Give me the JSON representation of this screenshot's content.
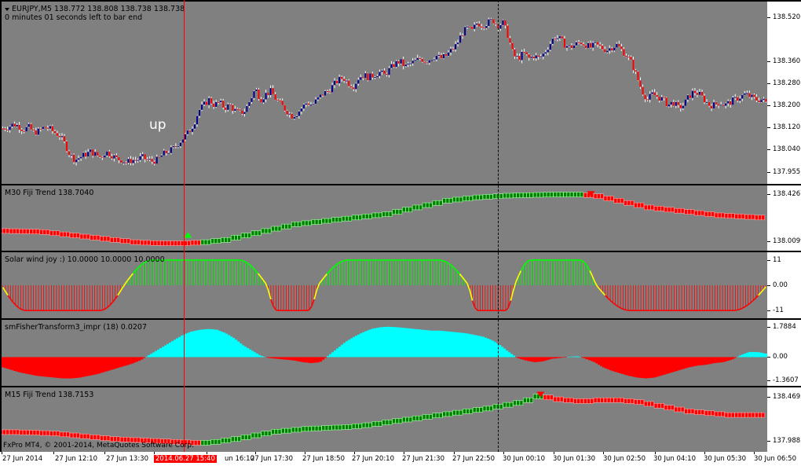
{
  "main": {
    "symbol_line": "EURJPY,M5  138.772 138.808 138.738 138.738",
    "countdown": "0 minutes 01 seconds left to bar end",
    "signal_label": "up",
    "scale_labels": [
      "138.520",
      "138.360",
      "138.280",
      "138.200",
      "138.120",
      "138.040",
      "137.955"
    ],
    "scale_values": [
      138.52,
      138.36,
      138.28,
      138.2,
      138.12,
      138.04,
      137.955
    ],
    "price_range": [
      137.93,
      138.56
    ],
    "close_path": [
      138.115,
      138.12,
      138.13,
      138.125,
      138.11,
      138.12,
      138.1,
      138.105,
      138.12,
      138.115,
      138.1,
      138.09,
      138.06,
      138.02,
      138.0,
      138.01,
      138.02,
      138.03,
      138.02,
      138.01,
      138.03,
      138.02,
      138.005,
      138.0,
      137.99,
      138.0,
      138.0,
      138.01,
      138.0,
      137.995,
      138.0,
      138.02,
      138.03,
      138.04,
      138.06,
      138.08,
      138.1,
      138.13,
      138.18,
      138.2,
      138.22,
      138.2,
      138.21,
      138.19,
      138.2,
      138.18,
      138.17,
      138.18,
      138.22,
      138.26,
      138.22,
      138.24,
      138.25,
      138.22,
      138.2,
      138.18,
      138.16,
      138.17,
      138.19,
      138.21,
      138.2,
      138.22,
      138.24,
      138.25,
      138.27,
      138.29,
      138.3,
      138.28,
      138.27,
      138.3,
      138.31,
      138.3,
      138.31,
      138.32,
      138.31,
      138.33,
      138.35,
      138.36,
      138.34,
      138.35,
      138.36,
      138.37,
      138.36,
      138.37,
      138.38,
      138.37,
      138.38,
      138.4,
      138.42,
      138.46,
      138.48,
      138.47,
      138.5,
      138.49,
      138.5,
      138.51,
      138.49,
      138.5,
      138.45,
      138.38,
      138.37,
      138.39,
      138.37,
      138.38,
      138.37,
      138.39,
      138.42,
      138.45,
      138.44,
      138.42,
      138.41,
      138.42,
      138.43,
      138.42,
      138.41,
      138.42,
      138.41,
      138.4,
      138.41,
      138.42,
      138.4,
      138.38,
      138.35,
      138.3,
      138.25,
      138.22,
      138.24,
      138.23,
      138.22,
      138.2,
      138.21,
      138.19,
      138.2,
      138.23,
      138.25,
      138.24,
      138.22,
      138.2,
      138.2,
      138.21,
      138.2,
      138.21,
      138.22,
      138.23,
      138.24,
      138.23,
      138.22,
      138.22,
      138.21
    ],
    "candle_colors": {
      "up": "#00008b",
      "down": "#ff0000",
      "wick": "#ffffff"
    }
  },
  "fiji_m30": {
    "title": "M30 Fiji Trend 138.7040",
    "scale_labels": [
      "138.4267",
      "138.0099"
    ],
    "scale_values": [
      138.4267,
      138.0099
    ],
    "range": [
      137.98,
      138.45
    ],
    "values": [
      138.1,
      138.098,
      138.096,
      138.094,
      138.09,
      138.08,
      138.07,
      138.06,
      138.05,
      138.04,
      138.03,
      138.02,
      138.01,
      138.0,
      137.995,
      137.992,
      137.99,
      137.99,
      137.99,
      137.995,
      138.0,
      138.01,
      138.02,
      138.04,
      138.06,
      138.08,
      138.1,
      138.12,
      138.14,
      138.16,
      138.17,
      138.18,
      138.19,
      138.2,
      138.21,
      138.22,
      138.23,
      138.24,
      138.25,
      138.27,
      138.29,
      138.31,
      138.33,
      138.35,
      138.37,
      138.38,
      138.39,
      138.4,
      138.405,
      138.41,
      138.415,
      138.418,
      138.42,
      138.422,
      138.424,
      138.425,
      138.425,
      138.425,
      138.42,
      138.41,
      138.39,
      138.37,
      138.35,
      138.33,
      138.31,
      138.3,
      138.29,
      138.28,
      138.27,
      138.26,
      138.25,
      138.24,
      138.235,
      138.23,
      138.225,
      138.22
    ],
    "trend": [
      "down",
      "down",
      "down",
      "down",
      "down",
      "down",
      "down",
      "down",
      "down",
      "down",
      "down",
      "down",
      "down",
      "down",
      "down",
      "down",
      "down",
      "down",
      "down",
      "down",
      "up",
      "up",
      "up",
      "up",
      "up",
      "up",
      "up",
      "up",
      "up",
      "up",
      "up",
      "up",
      "up",
      "up",
      "up",
      "up",
      "up",
      "up",
      "up",
      "up",
      "up",
      "up",
      "up",
      "up",
      "up",
      "up",
      "up",
      "up",
      "up",
      "up",
      "up",
      "up",
      "up",
      "up",
      "up",
      "up",
      "up",
      "up",
      "down",
      "down",
      "down",
      "down",
      "down",
      "down",
      "down",
      "down",
      "down",
      "down",
      "down",
      "down",
      "down",
      "down",
      "down",
      "down",
      "down",
      "down"
    ]
  },
  "solar": {
    "title": "Solar wind joy :) 10.0000 10.0000 10.0000",
    "scale_labels": [
      "11",
      "0.00",
      "-11"
    ],
    "scale_values": [
      11,
      0,
      -11
    ],
    "range": [
      -13,
      13
    ],
    "segments": [
      {
        "start": 0,
        "end": 48,
        "sign": -1
      },
      {
        "start": 48,
        "end": 104,
        "sign": 1
      },
      {
        "start": 104,
        "end": 124,
        "sign": -1
      },
      {
        "start": 124,
        "end": 183,
        "sign": 1
      },
      {
        "start": 183,
        "end": 201,
        "sign": -1
      },
      {
        "start": 201,
        "end": 233,
        "sign": 1
      },
      {
        "start": 233,
        "end": 300,
        "sign": -1
      }
    ],
    "colors": {
      "pos": "#00ff00",
      "neg": "#ff0000",
      "cross": "#ffff00"
    }
  },
  "fisher": {
    "title": "smFisherTransform3_impr  (18) 0.0207",
    "scale_labels": [
      "1.7884",
      "0.00",
      "-1.3607"
    ],
    "scale_values": [
      1.7884,
      0,
      -1.3607
    ],
    "range": [
      -1.5,
      2.0
    ],
    "values": [
      -0.6,
      -0.75,
      -0.9,
      -1.0,
      -1.1,
      -1.15,
      -1.2,
      -1.25,
      -1.25,
      -1.2,
      -1.1,
      -1.0,
      -0.85,
      -0.7,
      -0.55,
      -0.4,
      -0.2,
      0.1,
      0.4,
      0.7,
      1.0,
      1.3,
      1.5,
      1.6,
      1.65,
      1.6,
      1.4,
      1.1,
      0.7,
      0.4,
      0.1,
      -0.05,
      -0.1,
      -0.15,
      -0.2,
      -0.3,
      -0.35,
      -0.3,
      0.1,
      0.5,
      0.9,
      1.2,
      1.45,
      1.65,
      1.75,
      1.78,
      1.75,
      1.7,
      1.65,
      1.6,
      1.55,
      1.55,
      1.5,
      1.45,
      1.4,
      1.3,
      1.2,
      1.0,
      0.7,
      0.3,
      -0.05,
      -0.2,
      -0.3,
      -0.25,
      -0.1,
      -0.05,
      0.02,
      0.05,
      -0.1,
      -0.3,
      -0.6,
      -0.8,
      -0.95,
      -1.1,
      -1.2,
      -1.25,
      -1.2,
      -1.05,
      -0.9,
      -0.75,
      -0.6,
      -0.5,
      -0.45,
      -0.35,
      -0.3,
      -0.15,
      0.1,
      0.3,
      0.3,
      0.2
    ],
    "colors": {
      "pos": "#00ffff",
      "neg": "#ff0000"
    }
  },
  "fiji_m15": {
    "title": "M15 Fiji Trend 138.7153",
    "scale_labels": [
      "138.4691",
      "137.9881"
    ],
    "scale_values": [
      138.4691,
      137.9881
    ],
    "range": [
      137.94,
      138.5
    ],
    "values": [
      138.085,
      138.085,
      138.082,
      138.08,
      138.075,
      138.07,
      138.06,
      138.05,
      138.04,
      138.03,
      138.02,
      138.01,
      138.005,
      138.0,
      137.995,
      137.99,
      137.985,
      137.98,
      137.975,
      137.97,
      137.97,
      137.98,
      137.995,
      138.01,
      138.03,
      138.05,
      138.07,
      138.09,
      138.1,
      138.11,
      138.12,
      138.125,
      138.13,
      138.135,
      138.14,
      138.15,
      138.16,
      138.175,
      138.19,
      138.205,
      138.22,
      138.235,
      138.25,
      138.265,
      138.28,
      138.295,
      138.31,
      138.325,
      138.34,
      138.36,
      138.38,
      138.4,
      138.43,
      138.47,
      138.46,
      138.44,
      138.43,
      138.42,
      138.42,
      138.43,
      138.43,
      138.43,
      138.42,
      138.41,
      138.39,
      138.37,
      138.35,
      138.33,
      138.31,
      138.3,
      138.29,
      138.28,
      138.27,
      138.27,
      138.27,
      138.27
    ],
    "trend": [
      "down",
      "down",
      "down",
      "down",
      "down",
      "down",
      "down",
      "down",
      "down",
      "down",
      "down",
      "down",
      "down",
      "down",
      "down",
      "down",
      "down",
      "down",
      "down",
      "down",
      "up",
      "up",
      "up",
      "up",
      "up",
      "up",
      "up",
      "up",
      "up",
      "up",
      "up",
      "up",
      "up",
      "up",
      "up",
      "up",
      "up",
      "up",
      "up",
      "up",
      "up",
      "up",
      "up",
      "up",
      "up",
      "up",
      "up",
      "up",
      "up",
      "up",
      "up",
      "up",
      "up",
      "up",
      "down",
      "down",
      "down",
      "down",
      "down",
      "down",
      "down",
      "down",
      "down",
      "down",
      "down",
      "down",
      "down",
      "down",
      "down",
      "down",
      "down",
      "down",
      "down",
      "down",
      "down",
      "down"
    ]
  },
  "time_axis": {
    "labels": [
      "27 Jun 2014",
      "27 Jun 12:10",
      "27 Jun 13:30",
      "27 Jun 16:10",
      "27 Jun 17:30",
      "27 Jun 18:50",
      "27 Jun 20:10",
      "27 Jun 21:30",
      "27 Jun 22:50",
      "30 Jun 00:10",
      "30 Jun 01:30",
      "30 Jun 02:50",
      "30 Jun 04:10",
      "30 Jun 05:30",
      "30 Jun 06:50"
    ],
    "cursor_time": "2014.06.27 15:40"
  },
  "footer": {
    "copyright": "FxPro MT4, © 2001-2014, MetaQuotes Software Corp."
  }
}
